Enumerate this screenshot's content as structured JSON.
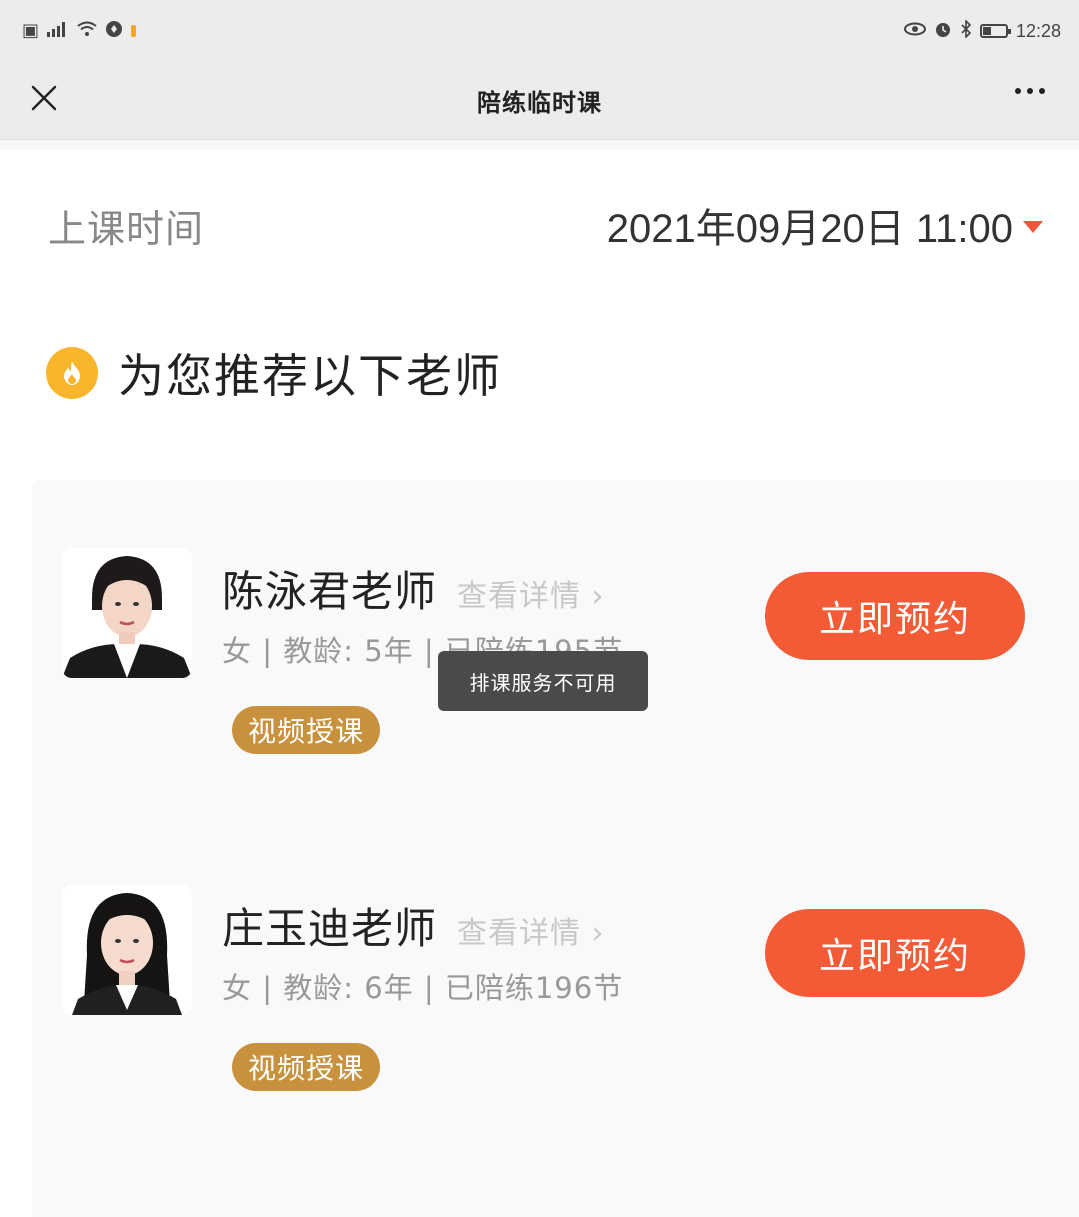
{
  "status_bar": {
    "time": "12:28",
    "left_icons": [
      "sim-icon",
      "signal-icon",
      "wifi-icon",
      "location-icon"
    ],
    "right_icons": [
      "eye-icon",
      "alarm-icon",
      "bluetooth-icon",
      "battery-icon"
    ]
  },
  "nav": {
    "title": "陪练临时课"
  },
  "schedule": {
    "label": "上课时间",
    "value": "2021年09月20日 11:00"
  },
  "recommend": {
    "title": "为您推荐以下老师"
  },
  "teachers": [
    {
      "name": "陈泳君老师",
      "detail_link": "查看详情 ›",
      "meta": "女 | 教龄:  5年 | 已陪练195节",
      "tag": "视频授课",
      "button": "立即预约"
    },
    {
      "name": "庄玉迪老师",
      "detail_link": "查看详情 ›",
      "meta": "女 | 教龄:  6年 | 已陪练196节",
      "tag": "视频授课",
      "button": "立即预约"
    }
  ],
  "toast": {
    "text": "排课服务不可用"
  },
  "colors": {
    "accent": "#f35b36",
    "tag": "#c8913d",
    "fire": "#f7b52b"
  }
}
